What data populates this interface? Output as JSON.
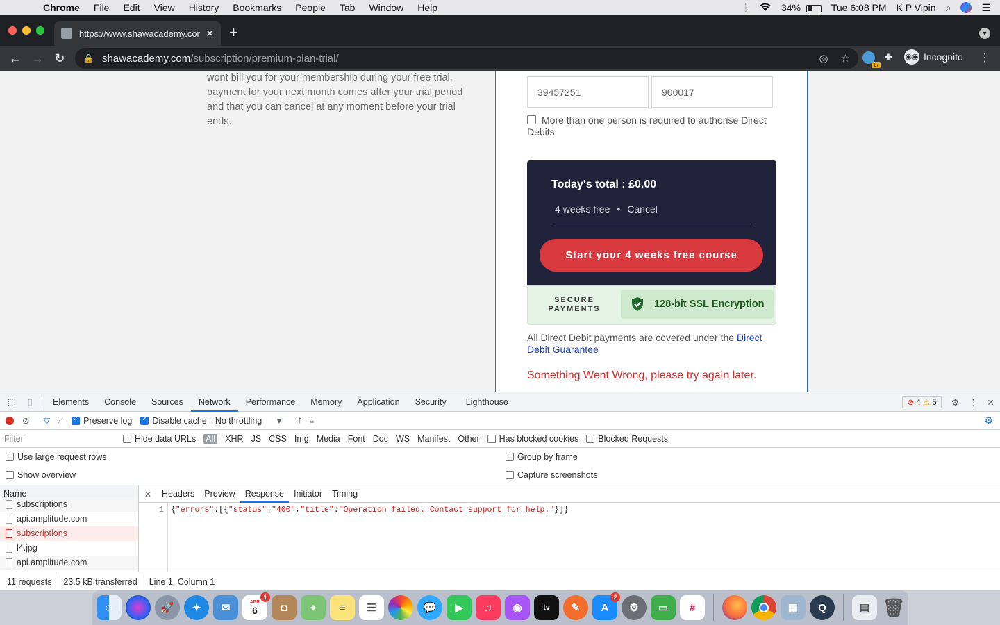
{
  "menubar": {
    "app": "Chrome",
    "items": [
      "File",
      "Edit",
      "View",
      "History",
      "Bookmarks",
      "People",
      "Tab",
      "Window",
      "Help"
    ],
    "battery": "34%",
    "battery_level": 0.34,
    "clock": "Tue 6:08 PM",
    "user": "K P Vipin"
  },
  "browser": {
    "tab_title": "https://www.shawacademy.com",
    "url_host": "shawacademy.com",
    "url_path": "/subscription/premium-plan-trial/",
    "incognito_label": "Incognito",
    "extension_badge": "17"
  },
  "page": {
    "left_copy": "wont bill you for your membership during your free trial, payment for your next month comes after your trial period and that you can cancel at any moment before your trial ends.",
    "account_number": "39457251",
    "sort_code": "900017",
    "multi_auth_label": "More than one person is required to authorise Direct Debits",
    "total_label": "Today's total : £0.00",
    "trial_label": "4 weeks free",
    "cancel_label": "Cancel",
    "cta_label": "Start your 4 weeks free course",
    "secure_label": "SECURE PAYMENTS",
    "ssl_label": "128-bit SSL Encryption",
    "dd_text": "All Direct Debit payments are covered under the ",
    "dd_link": "Direct Debit Guarantee",
    "error_text": "Something Went Wrong, please try again later.",
    "colors": {
      "navy": "#1f2239",
      "cta_red": "#d8393f",
      "ssl_green": "#1e5a1e",
      "error_red": "#d02b2b"
    }
  },
  "devtools": {
    "tabs": [
      "Elements",
      "Console",
      "Sources",
      "Network",
      "Performance",
      "Memory",
      "Application",
      "Security",
      "Lighthouse"
    ],
    "active_tab": "Network",
    "errors": "4",
    "warnings": "5",
    "preserve_log": "Preserve log",
    "disable_cache": "Disable cache",
    "throttling": "No throttling",
    "filter_placeholder": "Filter",
    "hide_data_urls": "Hide data URLs",
    "type_filters": [
      "All",
      "XHR",
      "JS",
      "CSS",
      "Img",
      "Media",
      "Font",
      "Doc",
      "WS",
      "Manifest",
      "Other"
    ],
    "has_blocked": "Has blocked cookies",
    "blocked_requests": "Blocked Requests",
    "large_rows": "Use large request rows",
    "group_frame": "Group by frame",
    "show_overview": "Show overview",
    "capture_screens": "Capture screenshots",
    "name_header": "Name",
    "requests": [
      {
        "name": "subscriptions",
        "error": false
      },
      {
        "name": "api.amplitude.com",
        "error": false
      },
      {
        "name": "subscriptions",
        "error": true
      },
      {
        "name": "l4.jpg",
        "error": false
      },
      {
        "name": "api.amplitude.com",
        "error": false
      }
    ],
    "detail_tabs": [
      "Headers",
      "Preview",
      "Response",
      "Initiator",
      "Timing"
    ],
    "active_detail": "Response",
    "line_number": "1",
    "response_text": "{\"errors\":[{\"status\":\"400\",\"title\":\"Operation failed. Contact support for help.\"}]}",
    "status_requests": "11 requests",
    "status_transferred": "23.5 kB transferred",
    "cursor": "Line 1, Column 1"
  },
  "dock": {
    "calendar_month": "APR",
    "calendar_day": "6",
    "calendar_badge": "1",
    "appstore_badge": "2"
  }
}
